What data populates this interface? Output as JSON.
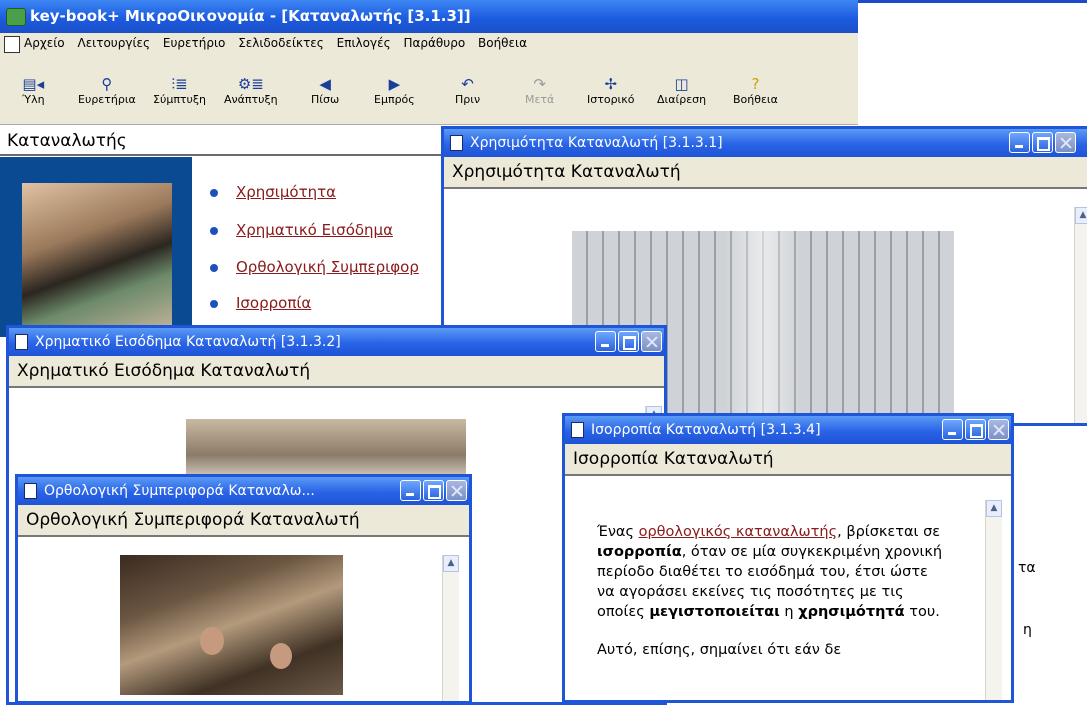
{
  "app": {
    "title": "key-book+  ΜικροΟικονομία - [Καταναλωτής  [3.1.3]]",
    "menu": [
      "Αρχείο",
      "Λειτουργίες",
      "Ευρετήριο",
      "Σελιδοδείκτες",
      "Επιλογές",
      "Παράθυρο",
      "Βοήθεια"
    ],
    "toolbar": [
      {
        "name": "Ύλη",
        "icon": "book-icon",
        "enabled": true
      },
      {
        "name": "Ευρετήρια",
        "icon": "magnifier-icon",
        "enabled": true
      },
      {
        "name": "Σύμπτυξη",
        "icon": "collapse-icon",
        "enabled": true
      },
      {
        "name": "Ανάπτυξη",
        "icon": "expand-icon",
        "enabled": true
      },
      {
        "name": "Πίσω",
        "icon": "back-arrow-icon",
        "enabled": true
      },
      {
        "name": "Εμπρός",
        "icon": "forward-arrow-icon",
        "enabled": true
      },
      {
        "name": "Πριν",
        "icon": "undo-icon",
        "enabled": true
      },
      {
        "name": "Μετά",
        "icon": "redo-icon",
        "enabled": false
      },
      {
        "name": "Ιστορικό",
        "icon": "history-icon",
        "enabled": true
      },
      {
        "name": "Διαίρεση",
        "icon": "split-icon",
        "enabled": true
      },
      {
        "name": "Βοήθεια",
        "icon": "help-icon",
        "enabled": true
      }
    ]
  },
  "main": {
    "heading": "Καταναλωτής",
    "links": [
      "Χρησιμότητα",
      "Χρηματικό Εισόδημα",
      "Ορθολογική Συμπεριφορ",
      "Ισορροπία"
    ]
  },
  "windows": {
    "utility": {
      "title": "Χρησιμότητα Καταναλωτή   [3.1.3.1]",
      "heading": "Χρησιμότητα Καταναλωτή"
    },
    "income": {
      "title": "Χρηματικό Εισόδημα Καταναλωτή   [3.1.3.2]",
      "heading": "Χρηματικό Εισόδημα Καταναλωτή"
    },
    "rational": {
      "title": "Ορθολογική Συμπεριφορά Καταναλω...",
      "heading": "Ορθολογική Συμπεριφορά Καταναλωτή"
    },
    "equilibrium": {
      "title": "Ισορροπία Καταναλωτή   [3.1.3.4]",
      "heading": "Ισορροπία Καταναλωτή",
      "p1_a": "Ένας ",
      "p1_link": "ορθολογικός καταναλωτής",
      "p1_b": ", βρίσκεται σε ",
      "p1_bold1": "ισορροπία",
      "p1_c": ", όταν σε μία συγκεκριμένη χρονική περίοδο διαθέτει το εισόδημά του, έτσι ώστε να αγοράσει εκείνες τις ποσότητες με τις οποίες ",
      "p1_bold2": "μεγιστοποιείται",
      "p1_d": " η ",
      "p1_bold3": "χρησιμότητά",
      "p1_e": " του.",
      "p2": "Αυτό, επίσης, σημαίνει ότι εάν δε",
      "peek1": "τα",
      "peek2": "η"
    }
  }
}
